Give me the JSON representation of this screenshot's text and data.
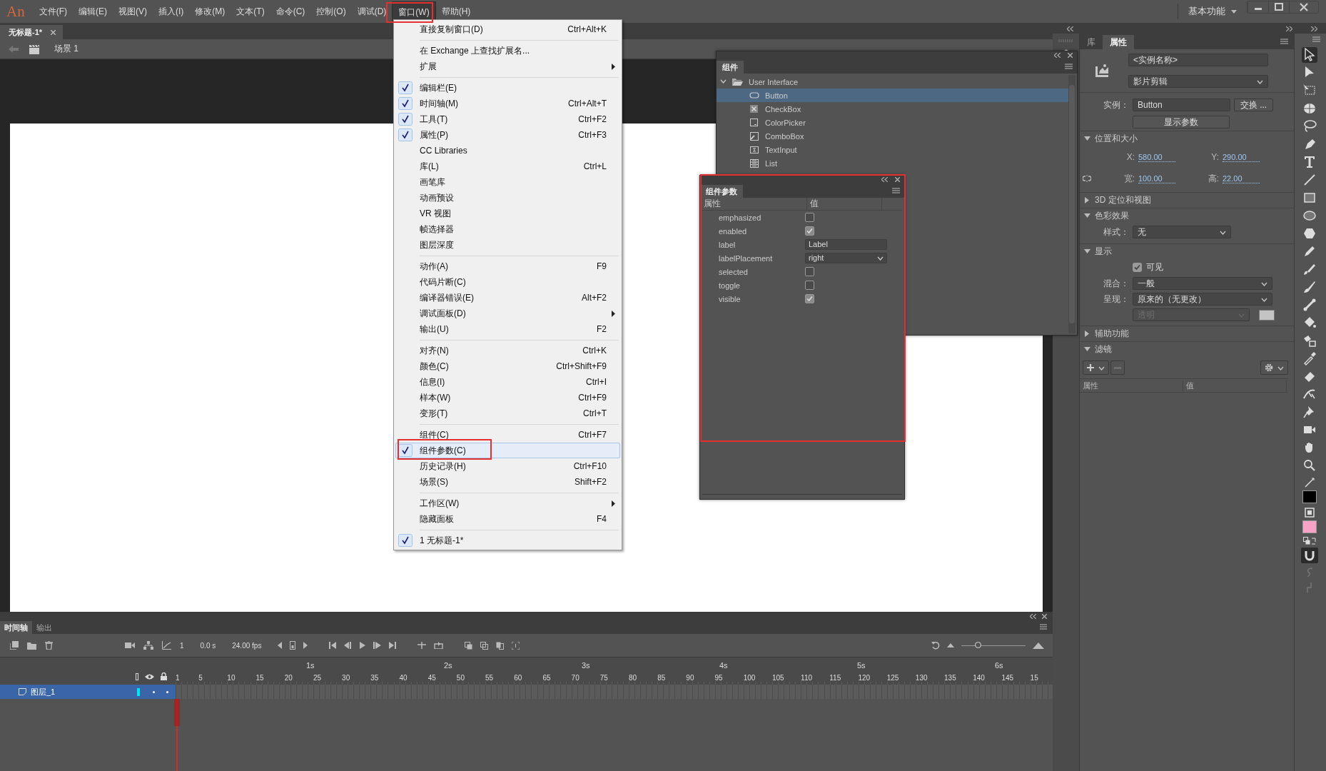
{
  "app": {
    "logo": "An",
    "menus": [
      {
        "label": "文件(F)",
        "selected": false
      },
      {
        "label": "编辑(E)",
        "selected": false
      },
      {
        "label": "视图(V)",
        "selected": false
      },
      {
        "label": "插入(I)",
        "selected": false
      },
      {
        "label": "修改(M)",
        "selected": false
      },
      {
        "label": "文本(T)",
        "selected": false
      },
      {
        "label": "命令(C)",
        "selected": false
      },
      {
        "label": "控制(O)",
        "selected": false
      },
      {
        "label": "调试(D)",
        "selected": false
      },
      {
        "label": "窗口(W)",
        "selected": true
      },
      {
        "label": "帮助(H)",
        "selected": false
      }
    ],
    "workspace": "基本功能"
  },
  "document_tab": {
    "title": "无标题-1*"
  },
  "scene": {
    "label": "场景 1"
  },
  "window_menu": {
    "items": [
      {
        "kind": "item",
        "label": "直接复制窗口(D)",
        "shortcut": "Ctrl+Alt+K",
        "checked": false,
        "submenu": false,
        "selected": false
      },
      {
        "kind": "separator"
      },
      {
        "kind": "item",
        "label": "在 Exchange 上查找扩展名...",
        "checked": false,
        "submenu": false,
        "selected": false
      },
      {
        "kind": "item",
        "label": "扩展",
        "checked": false,
        "submenu": true,
        "selected": false
      },
      {
        "kind": "separator"
      },
      {
        "kind": "item",
        "label": "编辑栏(E)",
        "checked": true,
        "submenu": false,
        "selected": false
      },
      {
        "kind": "item",
        "label": "时间轴(M)",
        "shortcut": "Ctrl+Alt+T",
        "checked": true,
        "submenu": false,
        "selected": false
      },
      {
        "kind": "item",
        "label": "工具(T)",
        "shortcut": "Ctrl+F2",
        "checked": true,
        "submenu": false,
        "selected": false
      },
      {
        "kind": "item",
        "label": "属性(P)",
        "shortcut": "Ctrl+F3",
        "checked": true,
        "submenu": false,
        "selected": false
      },
      {
        "kind": "item",
        "label": "CC Libraries",
        "checked": false,
        "submenu": false,
        "selected": false
      },
      {
        "kind": "item",
        "label": "库(L)",
        "shortcut": "Ctrl+L",
        "checked": false,
        "submenu": false,
        "selected": false
      },
      {
        "kind": "item",
        "label": "画笔库",
        "checked": false,
        "submenu": false,
        "selected": false
      },
      {
        "kind": "item",
        "label": "动画预设",
        "checked": false,
        "submenu": false,
        "selected": false
      },
      {
        "kind": "item",
        "label": "VR 视图",
        "checked": false,
        "submenu": false,
        "selected": false
      },
      {
        "kind": "item",
        "label": "帧选择器",
        "checked": false,
        "submenu": false,
        "selected": false
      },
      {
        "kind": "item",
        "label": "图层深度",
        "checked": false,
        "submenu": false,
        "selected": false
      },
      {
        "kind": "separator"
      },
      {
        "kind": "item",
        "label": "动作(A)",
        "shortcut": "F9",
        "checked": false,
        "submenu": false,
        "selected": false
      },
      {
        "kind": "item",
        "label": "代码片断(C)",
        "checked": false,
        "submenu": false,
        "selected": false
      },
      {
        "kind": "item",
        "label": "编译器错误(E)",
        "shortcut": "Alt+F2",
        "checked": false,
        "submenu": false,
        "selected": false
      },
      {
        "kind": "item",
        "label": "调试面板(D)",
        "checked": false,
        "submenu": true,
        "selected": false
      },
      {
        "kind": "item",
        "label": "输出(U)",
        "shortcut": "F2",
        "checked": false,
        "submenu": false,
        "selected": false
      },
      {
        "kind": "separator"
      },
      {
        "kind": "item",
        "label": "对齐(N)",
        "shortcut": "Ctrl+K",
        "checked": false,
        "submenu": false,
        "selected": false
      },
      {
        "kind": "item",
        "label": "颜色(C)",
        "shortcut": "Ctrl+Shift+F9",
        "checked": false,
        "submenu": false,
        "selected": false
      },
      {
        "kind": "item",
        "label": "信息(I)",
        "shortcut": "Ctrl+I",
        "checked": false,
        "submenu": false,
        "selected": false
      },
      {
        "kind": "item",
        "label": "样本(W)",
        "shortcut": "Ctrl+F9",
        "checked": false,
        "submenu": false,
        "selected": false
      },
      {
        "kind": "item",
        "label": "变形(T)",
        "shortcut": "Ctrl+T",
        "checked": false,
        "submenu": false,
        "selected": false
      },
      {
        "kind": "separator"
      },
      {
        "kind": "item",
        "label": "组件(C)",
        "shortcut": "Ctrl+F7",
        "checked": false,
        "submenu": false,
        "selected": false
      },
      {
        "kind": "item",
        "label": "组件参数(C)",
        "checked": true,
        "submenu": false,
        "selected": true
      },
      {
        "kind": "item",
        "label": "历史记录(H)",
        "shortcut": "Ctrl+F10",
        "checked": false,
        "submenu": false,
        "selected": false
      },
      {
        "kind": "item",
        "label": "场景(S)",
        "shortcut": "Shift+F2",
        "checked": false,
        "submenu": false,
        "selected": false
      },
      {
        "kind": "separator"
      },
      {
        "kind": "item",
        "label": "工作区(W)",
        "checked": false,
        "submenu": true,
        "selected": false
      },
      {
        "kind": "item",
        "label": "隐藏面板",
        "shortcut": "F4",
        "checked": false,
        "submenu": false,
        "selected": false
      },
      {
        "kind": "separator"
      },
      {
        "kind": "item",
        "label": "1 无标题-1*",
        "checked": true,
        "submenu": false,
        "selected": false
      }
    ]
  },
  "components_panel": {
    "tab": "组件",
    "tree": [
      {
        "label": "User Interface",
        "expanded": true,
        "children": [
          {
            "label": "Button",
            "kind": "button",
            "selected": true
          },
          {
            "label": "CheckBox",
            "kind": "checkbox",
            "selected": false
          },
          {
            "label": "ColorPicker",
            "kind": "colorpicker",
            "selected": false
          },
          {
            "label": "ComboBox",
            "kind": "combobox",
            "selected": false
          },
          {
            "label": "TextInput",
            "kind": "textinput",
            "selected": false
          },
          {
            "label": "List",
            "kind": "list",
            "selected": false
          }
        ]
      }
    ]
  },
  "component_parameters": {
    "tab": "组件参数",
    "columns": [
      "属性",
      "值"
    ],
    "rows": [
      {
        "name": "emphasized",
        "kind": "checkbox",
        "checked": false
      },
      {
        "name": "enabled",
        "kind": "checkbox",
        "checked": true
      },
      {
        "name": "label",
        "kind": "text",
        "value": "Label"
      },
      {
        "name": "labelPlacement",
        "kind": "dropdown",
        "value": "right"
      },
      {
        "name": "selected",
        "kind": "checkbox",
        "checked": false
      },
      {
        "name": "toggle",
        "kind": "checkbox",
        "checked": false
      },
      {
        "name": "visible",
        "kind": "checkbox",
        "checked": true
      }
    ]
  },
  "properties": {
    "tabs": [
      {
        "label": "库",
        "selected": false
      },
      {
        "label": "属性",
        "selected": true
      }
    ],
    "instance_name": {
      "placeholder": "<实例名称>"
    },
    "symbol_type": "影片剪辑",
    "instance_label": "实例：",
    "instance": "Button",
    "swap_button": "交换 ...",
    "show_params_button": "显示参数",
    "sections": [
      {
        "kind": "position",
        "title": "位置和大小",
        "expanded": true,
        "fields": [
          {
            "label": "X:",
            "value": "580.00"
          },
          {
            "label": "Y:",
            "value": "290.00"
          },
          {
            "label": "宽:",
            "value": "100.00"
          },
          {
            "label": "高:",
            "value": "22.00"
          }
        ]
      },
      {
        "kind": "spatial",
        "title": "3D 定位和视图",
        "expanded": false
      },
      {
        "kind": "color",
        "title": "色彩效果",
        "expanded": true,
        "style_label": "样式：",
        "style": "无"
      },
      {
        "kind": "display",
        "title": "显示",
        "expanded": true,
        "visible_label": "可见",
        "visible": true,
        "blend_label": "混合：",
        "blend": "一般",
        "render_label": "呈现：",
        "render": "原来的（无更改）",
        "transparency": "透明",
        "transparency_disabled": true
      },
      {
        "kind": "accessibility",
        "title": "辅助功能",
        "expanded": false
      },
      {
        "kind": "filters",
        "title": "滤镜",
        "expanded": true,
        "columns": [
          "属性",
          "值"
        ]
      }
    ]
  },
  "timeline": {
    "tabs": [
      {
        "label": "时间轴",
        "selected": true
      },
      {
        "label": "输出",
        "selected": false
      }
    ],
    "current_frame": "1",
    "time": "0.0 s",
    "fps": "24.00 fps",
    "zoom_slider": {
      "level": 0.25
    },
    "seconds": [
      "1s",
      "2s",
      "3s",
      "4s",
      "5s",
      "6s"
    ],
    "frames": [
      "1",
      "5",
      "10",
      "15",
      "20",
      "25",
      "30",
      "35",
      "40",
      "45",
      "50",
      "55",
      "60",
      "65",
      "70",
      "75",
      "80",
      "85",
      "90",
      "95",
      "100",
      "105",
      "110",
      "115",
      "120",
      "125",
      "130",
      "135",
      "140",
      "145",
      "15"
    ],
    "layers": [
      {
        "name": "图层_1",
        "selected": true,
        "color": "#00e5f5"
      }
    ]
  }
}
